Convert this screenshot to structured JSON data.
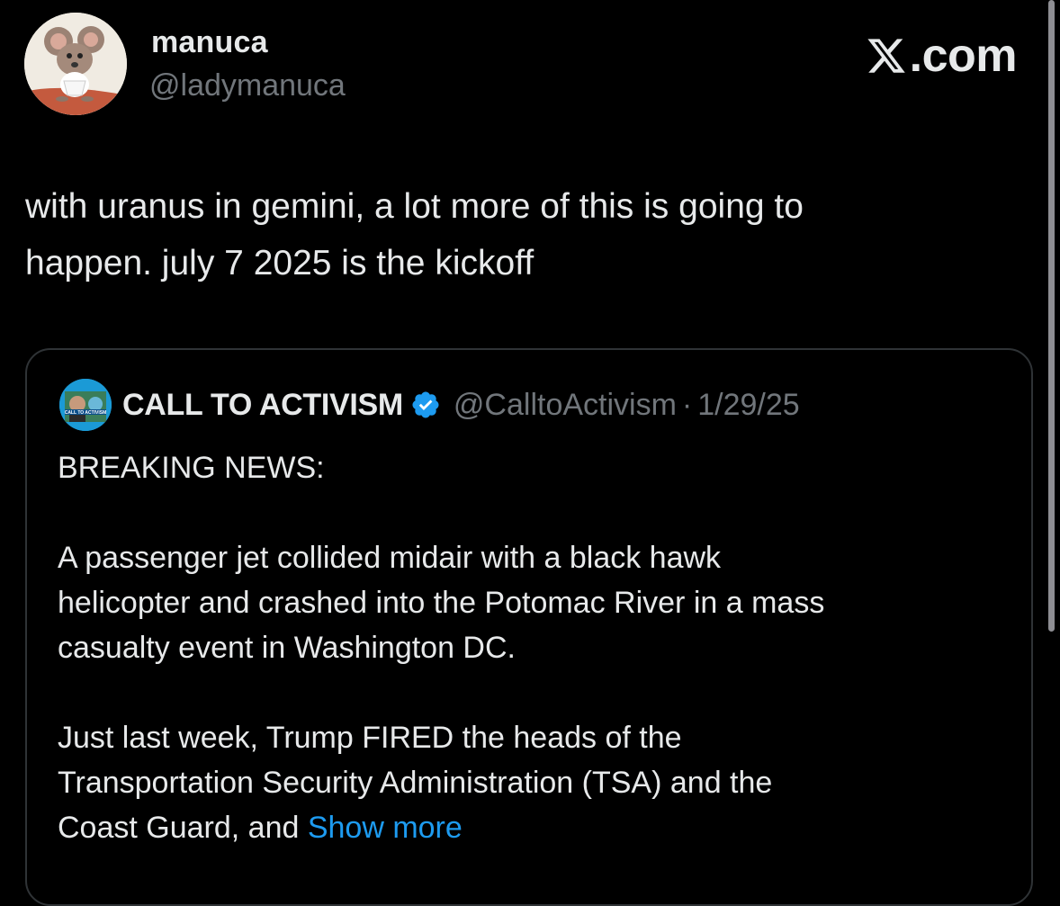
{
  "post": {
    "author_name": "manuca",
    "author_handle": "@ladymanuca",
    "text": "with uranus in gemini, a lot more of this is going to\nhappen. july 7 2025 is the kickoff"
  },
  "brand": {
    "label": ".com",
    "icon": "x-logo-icon"
  },
  "quoted_post": {
    "avatar_text": "CALL TO ACTIVISM",
    "name": "CALL TO ACTIVISM",
    "verified_icon": "verified-badge-icon",
    "handle": "@CalltoActivism",
    "separator": "·",
    "date": "1/29/25",
    "line1": "BREAKING NEWS:",
    "paragraph2": "A passenger jet collided midair with a black hawk\nhelicopter and crashed into the Potomac River in a mass\ncasualty event in Washington DC.",
    "paragraph3": "Just last week, Trump FIRED the heads of the\nTransportation Security Administration (TSA) and the\nCoast Guard, and ",
    "show_more": "Show more"
  },
  "colors": {
    "background": "#000000",
    "primary_text": "#e7e9ea",
    "secondary_text": "#71767b",
    "link": "#1d9bf0",
    "border": "#2f3336"
  }
}
